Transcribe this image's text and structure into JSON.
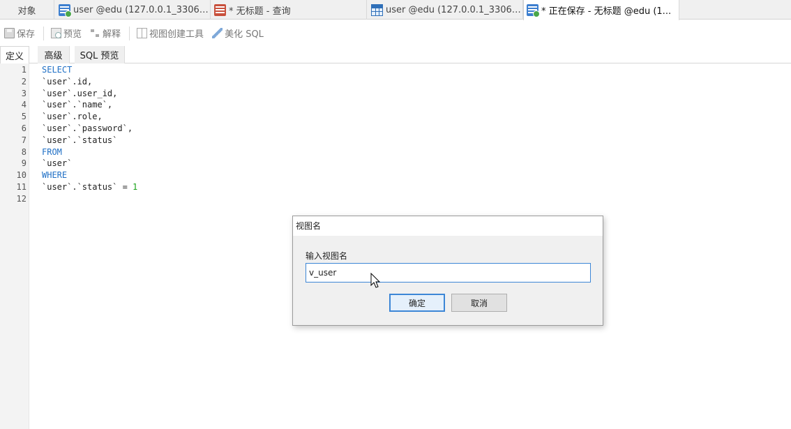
{
  "tabs": [
    {
      "label": "对象",
      "icon": ""
    },
    {
      "label": "user @edu (127.0.0.1_3306) ...",
      "icon": "view-designer-icon"
    },
    {
      "label": "* 无标题 - 查询",
      "icon": "query-icon"
    },
    {
      "label": "user @edu (127.0.0.1_3306) ...",
      "icon": "table-icon"
    },
    {
      "label": "* 正在保存 - 无标题 @edu (1...",
      "icon": "view-designer-icon"
    }
  ],
  "toolbar": {
    "save": "保存",
    "preview": "预览",
    "explain": "解释",
    "view_builder": "视图创建工具",
    "beautify": "美化 SQL"
  },
  "subtabs": [
    "定义",
    "高级",
    "SQL 预览"
  ],
  "editor": {
    "lines": [
      {
        "num": "1",
        "text": "SELECT"
      },
      {
        "num": "2",
        "text": "`user`.id,"
      },
      {
        "num": "3",
        "text": "`user`.user_id,"
      },
      {
        "num": "4",
        "text": "`user`.`name`,"
      },
      {
        "num": "5",
        "text": "`user`.role,"
      },
      {
        "num": "6",
        "text": "`user`.`password`,"
      },
      {
        "num": "7",
        "text": "`user`.`status`"
      },
      {
        "num": "8",
        "text": "FROM"
      },
      {
        "num": "9",
        "text": "`user`"
      },
      {
        "num": "10",
        "text": "WHERE"
      },
      {
        "num": "11",
        "text": "`user`.`status` = ",
        "num_literal": "1"
      },
      {
        "num": "12",
        "text": ""
      }
    ]
  },
  "dialog": {
    "title": "视图名",
    "label": "输入视图名",
    "value": "v_user",
    "ok": "确定",
    "cancel": "取消"
  },
  "colors": {
    "keyword": "#1f6fc5",
    "number_literal": "#17a117",
    "focus_border": "#3c86d6"
  }
}
